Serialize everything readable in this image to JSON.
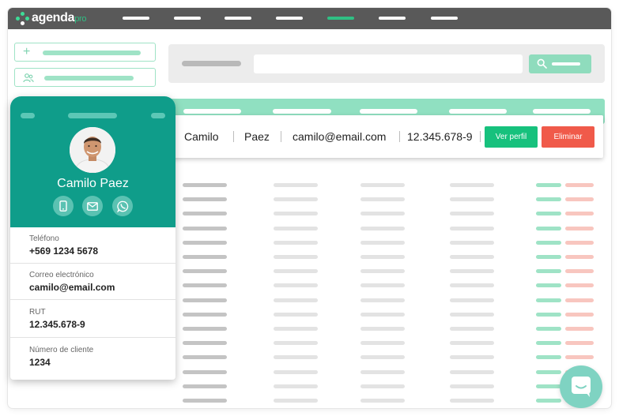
{
  "app": {
    "logo_main": "agenda",
    "logo_accent": "pro"
  },
  "nav": {
    "items": 7,
    "active_index": 4
  },
  "contact_row": {
    "first_name": "Camilo",
    "last_name": "Paez",
    "email": "camilo@email.com",
    "rut": "12.345.678-9",
    "view_label": "Ver perfil",
    "delete_label": "Eliminar"
  },
  "card": {
    "name": "Camilo Paez",
    "fields": [
      {
        "label": "Teléfono",
        "value": "+569 1234 5678"
      },
      {
        "label": "Correo electrónico",
        "value": "camilo@email.com"
      },
      {
        "label": "RUT",
        "value": "12.345.678-9"
      },
      {
        "label": "Número de cliente",
        "value": "1234"
      }
    ],
    "icons": [
      "phone-icon",
      "mail-icon",
      "whatsapp-icon"
    ]
  },
  "colors": {
    "topbar": "#595959",
    "brand_green": "#2fbf84",
    "card_teal": "#0f9d8a",
    "view_button": "#17c17d",
    "delete_button": "#f05a4a",
    "table_header": "#90e0c1"
  }
}
